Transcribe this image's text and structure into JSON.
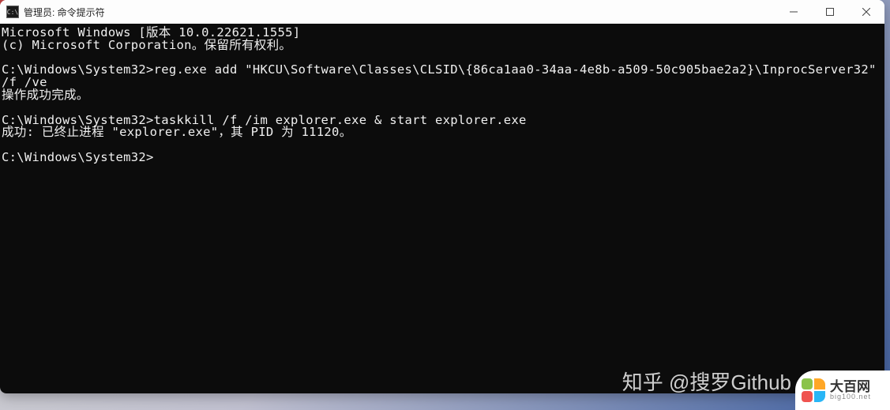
{
  "window": {
    "icon_text": "C:\\",
    "title": "管理员: 命令提示符"
  },
  "terminal": {
    "line1": "Microsoft Windows [版本 10.0.22621.1555]",
    "line2": "(c) Microsoft Corporation。保留所有权利。",
    "blank1": "",
    "line3": "C:\\Windows\\System32>reg.exe add \"HKCU\\Software\\Classes\\CLSID\\{86ca1aa0-34aa-4e8b-a509-50c905bae2a2}\\InprocServer32\" /f /ve",
    "line4": "操作成功完成。",
    "blank2": "",
    "line5": "C:\\Windows\\System32>taskkill /f /im explorer.exe & start explorer.exe",
    "line6": "成功: 已终止进程 \"explorer.exe\"，其 PID 为 11120。",
    "blank3": "",
    "line7": "C:\\Windows\\System32>"
  },
  "watermark": "知乎 @搜罗Github",
  "site": {
    "name": "大百网",
    "domain": "big100.net"
  }
}
